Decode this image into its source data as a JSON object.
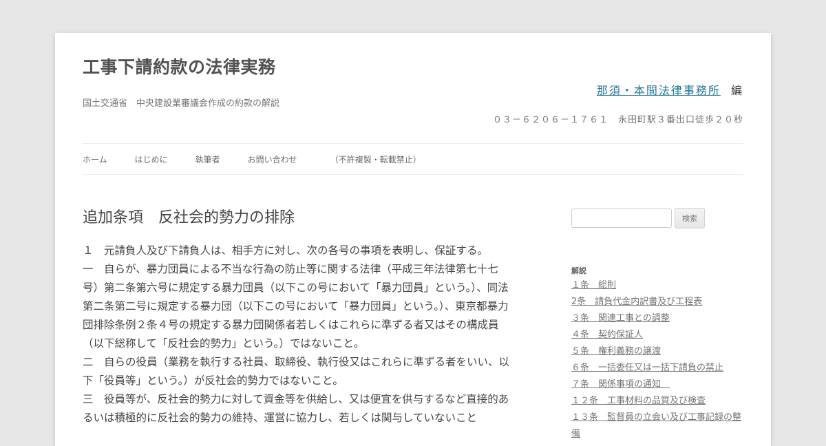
{
  "site": {
    "title": "工事下請約款の法律実務",
    "tagline": "国土交通省　中央建設業審議会作成の約款の解説",
    "firm_link": "那須・本間法律事務所",
    "firm_suffix": "編",
    "phone": "０３－６２０６－１７６１　永田町駅３番出口徒歩２０秒"
  },
  "nav": {
    "items": [
      "ホーム",
      "はじめに",
      "執筆者",
      "お問い合わせ"
    ],
    "notice": "（不許複製・転載禁止）"
  },
  "main": {
    "title": "追加条項　反社会的勢力の排除",
    "paragraphs": [
      "１　元請負人及び下請負人は、相手方に対し、次の各号の事項を表明し、保証する。",
      "一　自らが、暴力団員による不当な行為の防止等に関する法律（平成三年法律第七十七号）第二条第六号に規定する暴力団員（以下この号において「暴力団員」という。）、同法第二条第二号に規定する暴力団（以下この号において「暴力団員」という。）、東京都暴力団排除条例２条４号の規定する暴力団関係者若しくはこれらに準ずる者又はその構成員（以下総称して「反社会的勢力」という。）ではないこと。",
      "二　自らの役員（業務を執行する社員、取締役、執行役又はこれらに準ずる者をいい、以下「役員等」という。）が反社会的勢力ではないこと。",
      "三　役員等が、反社会的勢力に対して資金等を供給し、又は便宜を供与するなど直接的あるいは積極的に反社会的勢力の維持、運営に協力し、若しくは関与していないこと"
    ]
  },
  "sidebar": {
    "search_button": "検索",
    "search_placeholder": "",
    "widget_title": "解説",
    "links": [
      "１条　総則",
      "2条　請負代金内訳書及び工程表",
      "３条　関連工事との調整",
      "４条　契約保証人",
      "５条　権利義務の譲渡",
      "６条　一括委任又は一括下請負の禁止",
      "７条　関係事項の通知　",
      "１２条　工事材料の品質及び検査",
      "１３条　監督員の立会い及び工事記録の整備"
    ]
  }
}
